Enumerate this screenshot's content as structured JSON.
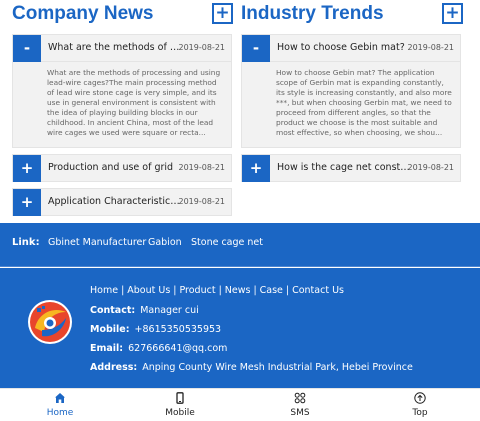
{
  "left_column": {
    "title": "Company News",
    "add_symbol": "+",
    "expanded": {
      "toggle": "-",
      "title": "What are the methods of proc...",
      "date": "2019-08-21",
      "body": "What are the methods of processing and using lead-wire cages?The main processing method of lead wire stone cage is very simple, and its use in general environment is consistent with the idea of playing building blocks in our childhood. In ancient China, most of the lead wire cages we used were square or recta..."
    },
    "items": [
      {
        "toggle": "+",
        "title": "Production and use of grid",
        "date": "2019-08-21"
      },
      {
        "toggle": "+",
        "title": "Application Characteristics of ...",
        "date": "2019-08-21"
      }
    ]
  },
  "right_column": {
    "title": "Industry Trends",
    "add_symbol": "+",
    "expanded": {
      "toggle": "-",
      "title": "How to choose Gebin mat?",
      "date": "2019-08-21",
      "body": "How to choose Gebin mat? The application scope of Gerbin mat is expanding constantly, its style is increasing constantly, and also more ***, but when choosing Gerbin mat, we need to proceed from different angles, so that the product we choose is the most suitable and most effective, so when choosing, we shou..."
    },
    "items": [
      {
        "toggle": "+",
        "title": "How is the cage net construct...",
        "date": "2019-08-21"
      }
    ]
  },
  "links": {
    "label": "Link:",
    "items": [
      "Gbinet Manufacturer",
      "Gabion",
      "Stone cage net"
    ]
  },
  "footer": {
    "nav": [
      "Home",
      "About Us",
      "Product",
      "News",
      "Case",
      "Contact Us"
    ],
    "separator": "|",
    "contact": {
      "label": "Contact:",
      "value": "Manager cui"
    },
    "mobile": {
      "label": "Mobile:",
      "value": "+8615350535953"
    },
    "email": {
      "label": "Email:",
      "value": "627666641@qq.com"
    },
    "address": {
      "label": "Address:",
      "value": "Anping County Wire Mesh Industrial Park, Hebei Province"
    }
  },
  "tabbar": {
    "tabs": [
      {
        "label": "Home",
        "icon": "home-icon",
        "active": true
      },
      {
        "label": "Mobile",
        "icon": "phone-icon",
        "active": false
      },
      {
        "label": "SMS",
        "icon": "grid-icon",
        "active": false
      },
      {
        "label": "Top",
        "icon": "arrow-up-icon",
        "active": false
      }
    ]
  },
  "colors": {
    "primary": "#1b66c4",
    "panel": "#f2f2f2",
    "text": "#222222",
    "muted": "#666666"
  }
}
